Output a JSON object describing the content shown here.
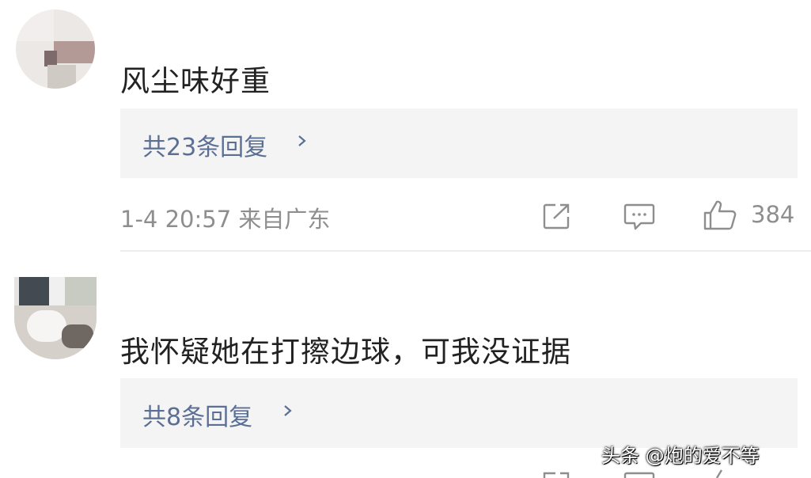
{
  "comments": [
    {
      "text": "风尘味好重",
      "replies_label": "共23条回复",
      "timestamp": "1-4 20:57 来自广东",
      "like_count": "384"
    },
    {
      "text": "我怀疑她在打擦边球，可我没证据",
      "replies_label": "共8条回复",
      "timestamp": "",
      "like_count": ""
    }
  ],
  "watermark": "头条 @炮的爱不等",
  "icons": {
    "share": "share-icon",
    "comment": "comment-icon",
    "like": "thumbs-up-icon",
    "chevron": "chevron-right-icon"
  },
  "colors": {
    "reply_link": "#5b6f94",
    "meta_text": "#8e8e8e",
    "reply_bg": "#f4f4f4"
  }
}
